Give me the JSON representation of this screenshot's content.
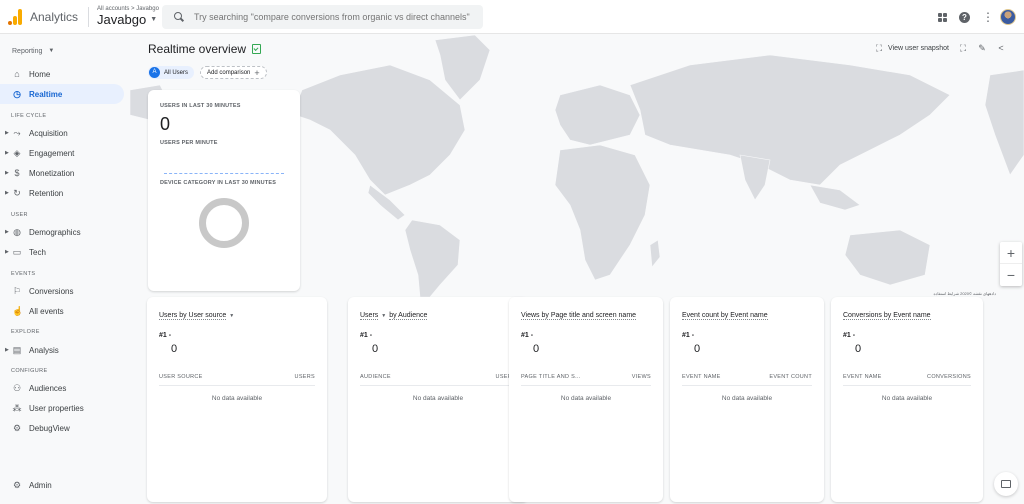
{
  "topbar": {
    "app_name": "Analytics",
    "breadcrumb": "All accounts > Javabgo",
    "property": "Javabgo",
    "search_placeholder": "Try searching \"compare conversions from organic vs direct channels\"",
    "icons": [
      "apps-icon",
      "help-icon",
      "more-vert-icon",
      "avatar"
    ]
  },
  "sidebar": {
    "reporting_label": "Reporting",
    "home": "Home",
    "realtime": "Realtime",
    "sections": {
      "life_cycle": "LIFE CYCLE",
      "user": "USER",
      "events": "EVENTS",
      "explore": "EXPLORE",
      "configure": "CONFIGURE"
    },
    "items": {
      "acquisition": "Acquisition",
      "engagement": "Engagement",
      "monetization": "Monetization",
      "retention": "Retention",
      "demographics": "Demographics",
      "tech": "Tech",
      "conversions": "Conversions",
      "all_events": "All events",
      "analysis": "Analysis",
      "audiences": "Audiences",
      "user_properties": "User properties",
      "debugview": "DebugView"
    },
    "admin": "Admin"
  },
  "main": {
    "title": "Realtime overview",
    "chip_all_users_letter": "A",
    "chip_all_users": "All Users",
    "add_comparison": "Add comparison",
    "view_user_snapshot": "View user snapshot",
    "map_attribution": "دادههای نقشه ©2020 شرایط استفاده",
    "zoom_in": "+",
    "zoom_out": "−"
  },
  "realtime_card": {
    "users_label": "USERS IN LAST 30 MINUTES",
    "users_value": "0",
    "per_minute_label": "USERS PER MINUTE",
    "device_label": "DEVICE CATEGORY IN LAST 30 MINUTES"
  },
  "cards": [
    {
      "title_a": "Users by User source",
      "title_b": "",
      "rank": "#1  -",
      "value": "0",
      "col_left": "USER SOURCE",
      "col_right": "USERS",
      "empty": "No data available"
    },
    {
      "title_a": "Users",
      "title_b": "by Audience",
      "rank": "#1  -",
      "value": "0",
      "col_left": "AUDIENCE",
      "col_right": "USERS",
      "empty": "No data available"
    },
    {
      "title_a": "Views by Page title and screen name",
      "title_b": "",
      "rank": "#1  -",
      "value": "0",
      "col_left": "PAGE TITLE AND S...",
      "col_right": "VIEWS",
      "empty": "No data available"
    },
    {
      "title_a": "Event count by Event name",
      "title_b": "",
      "rank": "#1  -",
      "value": "0",
      "col_left": "EVENT NAME",
      "col_right": "EVENT COUNT",
      "empty": "No data available"
    },
    {
      "title_a": "Conversions by Event name",
      "title_b": "",
      "rank": "#1  -",
      "value": "0",
      "col_left": "EVENT NAME",
      "col_right": "CONVERSIONS",
      "empty": "No data available"
    }
  ]
}
